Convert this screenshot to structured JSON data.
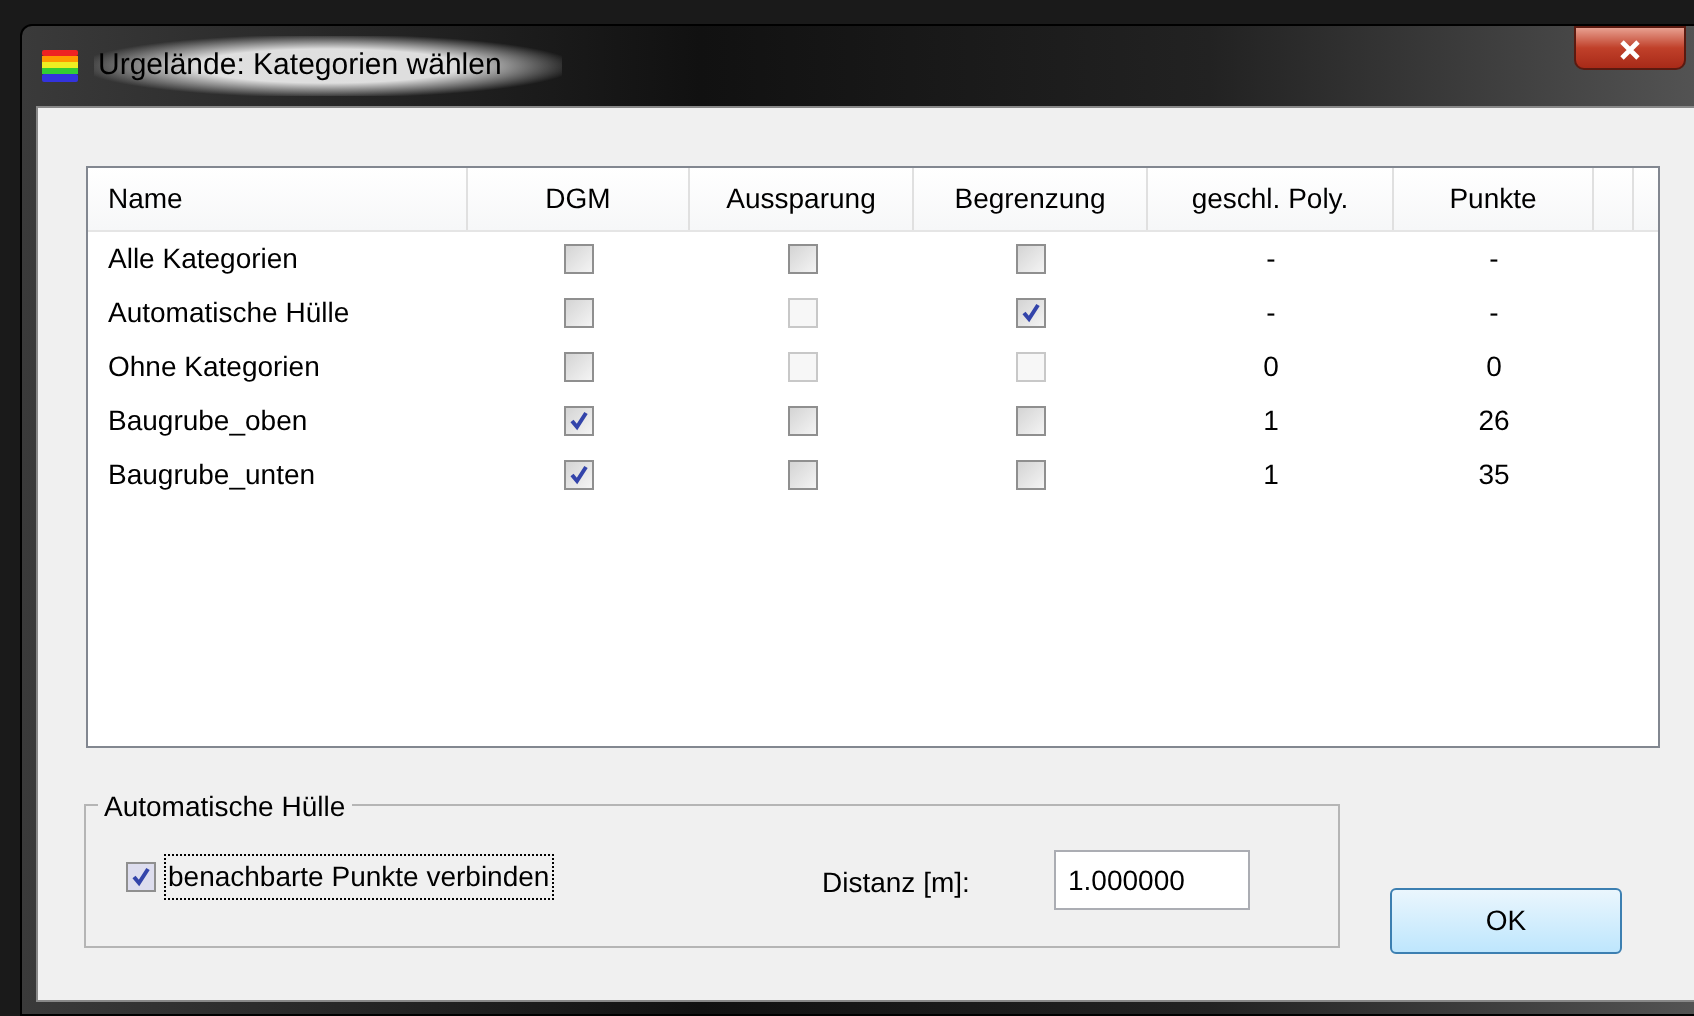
{
  "window": {
    "title": "Urgelände: Kategorien wählen"
  },
  "table": {
    "columns": [
      "Name",
      "DGM",
      "Aussparung",
      "Begrenzung",
      "geschl. Poly.",
      "Punkte"
    ],
    "rows": [
      {
        "name": "Alle Kategorien",
        "dgm": {
          "checked": false,
          "disabled": false
        },
        "aussparung": {
          "checked": false,
          "disabled": false
        },
        "begrenzung": {
          "checked": false,
          "disabled": false
        },
        "poly": "-",
        "punkte": "-"
      },
      {
        "name": "Automatische Hülle",
        "dgm": {
          "checked": false,
          "disabled": false
        },
        "aussparung": {
          "checked": false,
          "disabled": true
        },
        "begrenzung": {
          "checked": true,
          "disabled": false
        },
        "poly": "-",
        "punkte": "-"
      },
      {
        "name": "Ohne Kategorien",
        "dgm": {
          "checked": false,
          "disabled": false
        },
        "aussparung": {
          "checked": false,
          "disabled": true
        },
        "begrenzung": {
          "checked": false,
          "disabled": true
        },
        "poly": "0",
        "punkte": "0"
      },
      {
        "name": "Baugrube_oben",
        "dgm": {
          "checked": true,
          "disabled": false
        },
        "aussparung": {
          "checked": false,
          "disabled": false
        },
        "begrenzung": {
          "checked": false,
          "disabled": false
        },
        "poly": "1",
        "punkte": "26"
      },
      {
        "name": "Baugrube_unten",
        "dgm": {
          "checked": true,
          "disabled": false
        },
        "aussparung": {
          "checked": false,
          "disabled": false
        },
        "begrenzung": {
          "checked": false,
          "disabled": false
        },
        "poly": "1",
        "punkte": "35"
      }
    ]
  },
  "hull_group": {
    "title": "Automatische Hülle",
    "connect": {
      "label": "benachbarte Punkte verbinden",
      "checked": true
    },
    "distance": {
      "label": "Distanz [m]:",
      "value": "1.000000"
    }
  },
  "buttons": [
    "OK"
  ]
}
